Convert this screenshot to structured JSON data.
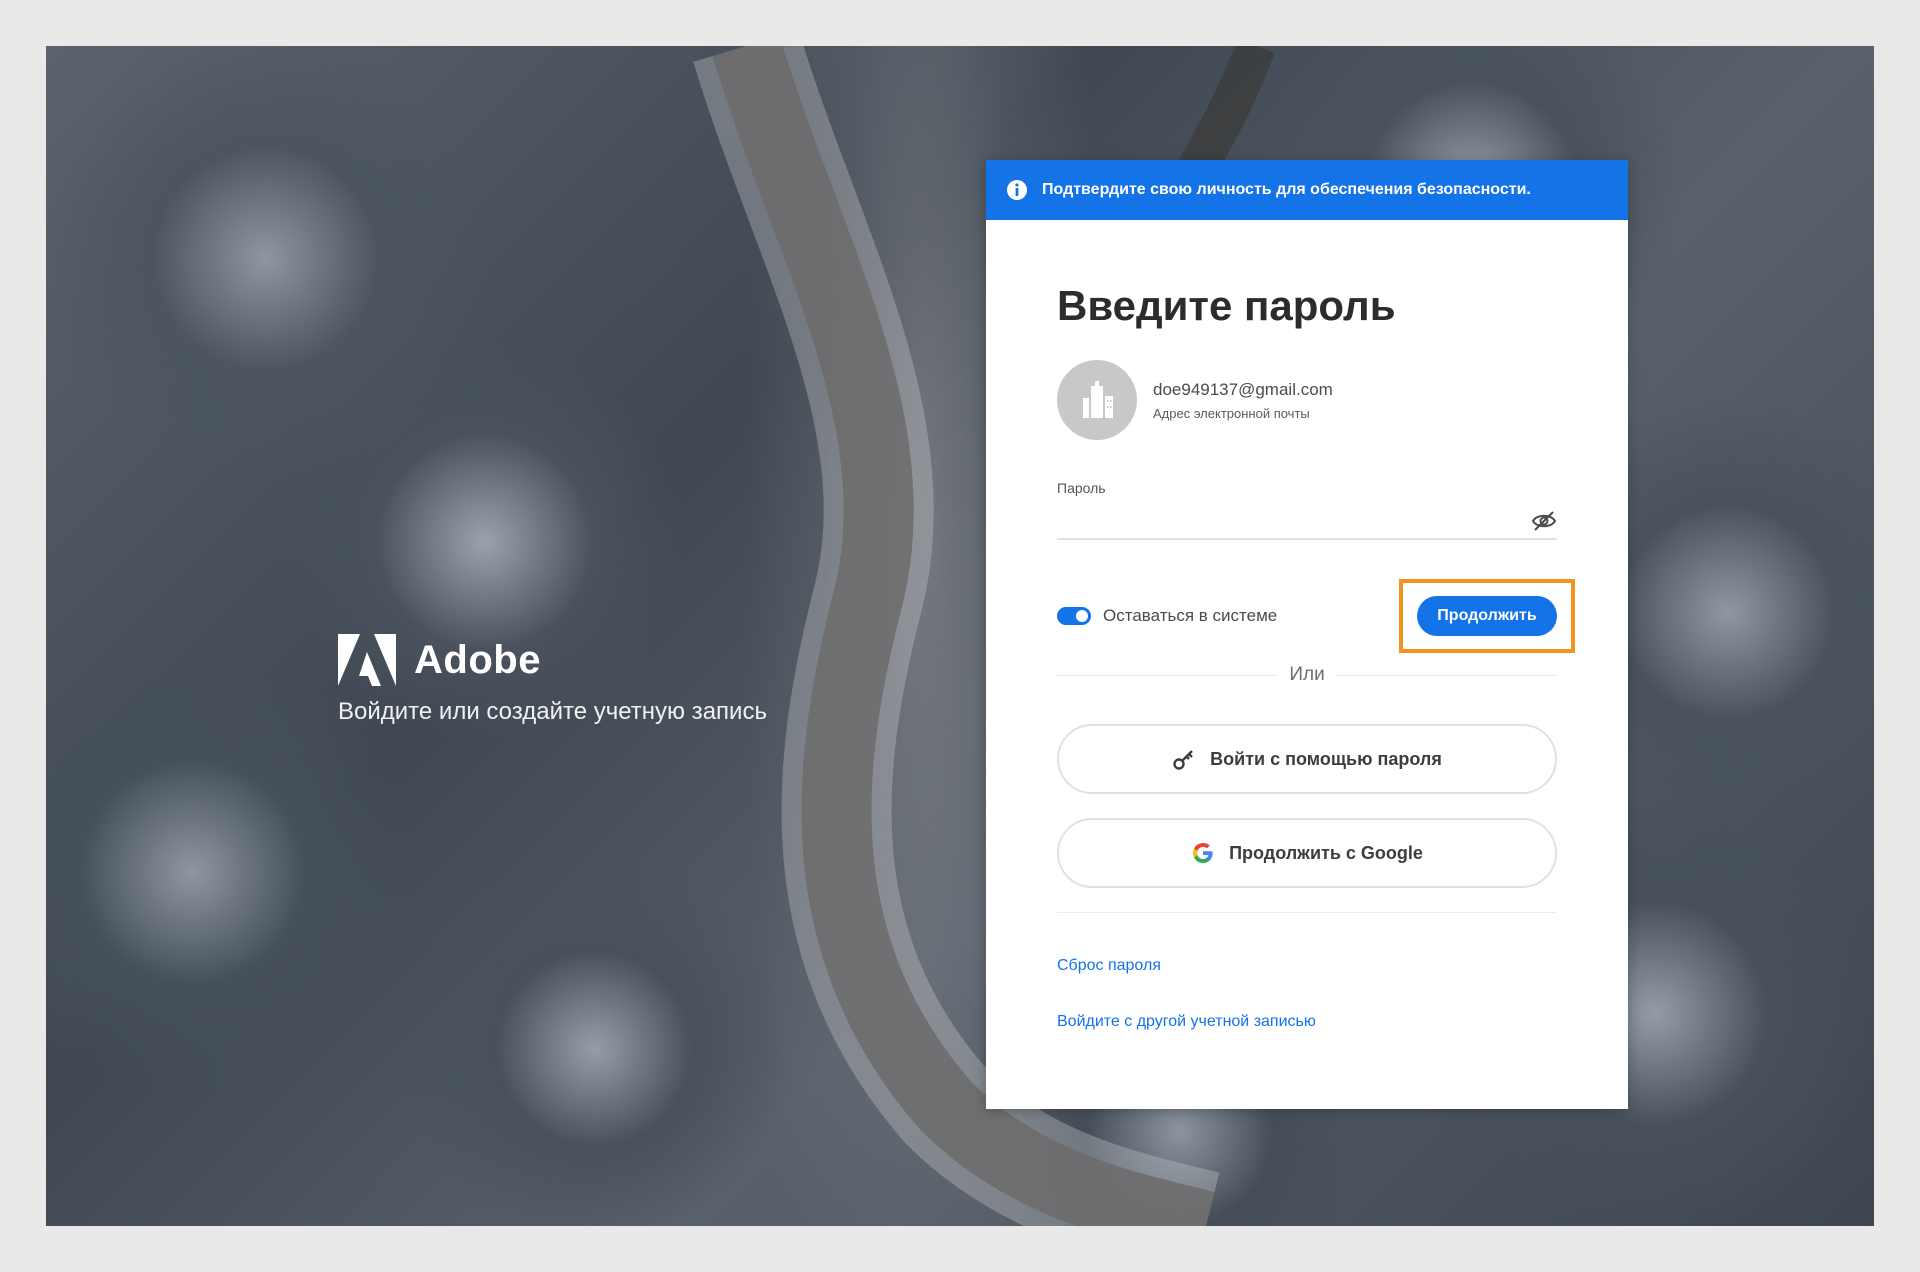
{
  "branding": {
    "name": "Adobe",
    "tagline": "Войдите или создайте учетную запись"
  },
  "banner": {
    "text": "Подтвердите свою личность для обеспечения безопасности."
  },
  "form": {
    "title": "Введите пароль",
    "account": {
      "email": "doe949137@gmail.com",
      "subtitle": "Адрес электронной почты"
    },
    "password_label": "Пароль",
    "password_value": "",
    "stay_signed_in_label": "Оставаться в системе",
    "stay_signed_in": true,
    "continue_label": "Продолжить",
    "or_label": "Или",
    "password_login_label": "Войти с помощью пароля",
    "google_label": "Продолжить с Google",
    "reset_link": "Сброс пароля",
    "other_account_link": "Войдите с другой учетной записью"
  },
  "colors": {
    "accent": "#1473e6",
    "highlight": "#f2931e"
  },
  "icons": {
    "banner": "info-icon",
    "avatar": "building-icon",
    "password_visibility": "eye-off-icon",
    "password_login": "key-icon",
    "google": "google-icon",
    "brand": "adobe-logo-icon"
  }
}
